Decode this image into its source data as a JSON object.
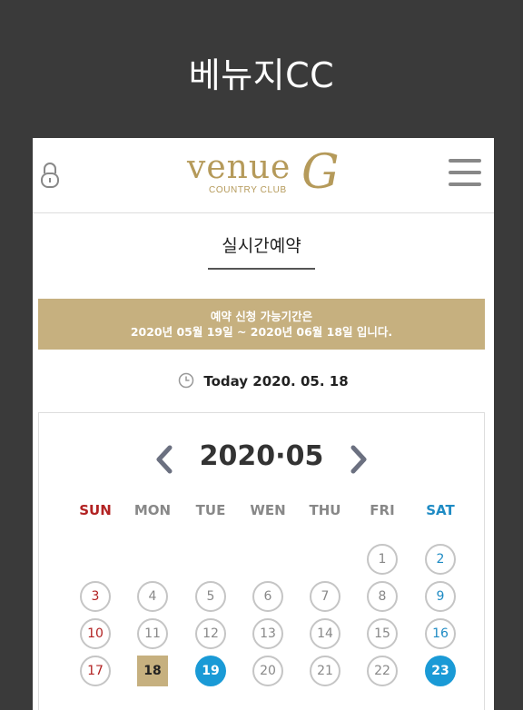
{
  "page": {
    "title": "베뉴지CC"
  },
  "header": {
    "logo_main": "venue",
    "logo_sub": "COUNTRY CLUB",
    "logo_mark": "G",
    "left_icon": "lock-icon",
    "right_icon": "menu-icon"
  },
  "section": {
    "title": "실시간예약"
  },
  "notice": {
    "line1": "예약 신청 가능기간은",
    "line2": "2020년 05월 19일 ~ 2020년 06월 18일 입니다."
  },
  "today": {
    "label": "Today 2020. 05. 18",
    "icon": "clock-icon"
  },
  "calendar": {
    "month": "2020·05",
    "weekdays": [
      "SUN",
      "MON",
      "TUE",
      "WEN",
      "THU",
      "FRI",
      "SAT"
    ],
    "weeks": [
      [
        "",
        "",
        "",
        "",
        "",
        "1",
        "2"
      ],
      [
        "3",
        "4",
        "5",
        "6",
        "7",
        "8",
        "9"
      ],
      [
        "10",
        "11",
        "12",
        "13",
        "14",
        "15",
        "16"
      ],
      [
        "17",
        "18",
        "19",
        "20",
        "21",
        "22",
        "23"
      ],
      [
        "",
        "",
        "",
        "",
        "",
        "",
        ""
      ]
    ],
    "today_date": "18",
    "available_dates": [
      "19",
      "23"
    ],
    "colors": {
      "gold": "#c6b07f",
      "available": "#1a9ad6",
      "sunday": "#b22222",
      "saturday": "#1f8bc4"
    }
  }
}
